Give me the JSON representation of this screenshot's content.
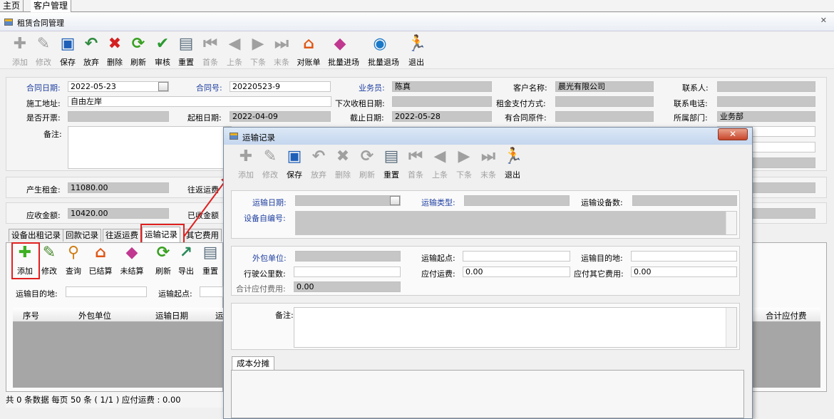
{
  "top_tabs": [
    "主页",
    "客户管理"
  ],
  "window": {
    "title": "租赁合同管理",
    "close": "✕"
  },
  "toolbar": [
    {
      "label": "添加",
      "icon": "add-icon",
      "glyph": "✚",
      "color": "#a0a0a0",
      "disabled": true
    },
    {
      "label": "修改",
      "icon": "edit-icon",
      "glyph": "✎",
      "color": "#a0a0a0",
      "disabled": true
    },
    {
      "label": "保存",
      "icon": "save-icon",
      "glyph": "▣",
      "color": "#1e5fb8",
      "disabled": false
    },
    {
      "label": "放弃",
      "icon": "undo-icon",
      "glyph": "↶",
      "color": "#2e8b3e",
      "disabled": false
    },
    {
      "label": "删除",
      "icon": "delete-icon",
      "glyph": "✖",
      "color": "#d42020",
      "disabled": false
    },
    {
      "label": "刷新",
      "icon": "refresh-icon",
      "glyph": "⟳",
      "color": "#38a020",
      "disabled": false
    },
    {
      "label": "审核",
      "icon": "spellcheck-icon",
      "glyph": "✔",
      "color": "#2a9a30",
      "disabled": false
    },
    {
      "label": "重置",
      "icon": "reset-icon",
      "glyph": "▤",
      "color": "#5a6e7e",
      "disabled": false
    },
    {
      "label": "首条",
      "icon": "first-record-icon",
      "glyph": "⏮",
      "color": "#a0a0a0",
      "disabled": true
    },
    {
      "label": "上条",
      "icon": "previous-record-icon",
      "glyph": "◀",
      "color": "#a0a0a0",
      "disabled": true
    },
    {
      "label": "下条",
      "icon": "next-record-icon",
      "glyph": "▶",
      "color": "#a0a0a0",
      "disabled": true
    },
    {
      "label": "末条",
      "icon": "last-record-icon",
      "glyph": "⏭",
      "color": "#a0a0a0",
      "disabled": true
    },
    {
      "label": "对账单",
      "icon": "statement-icon",
      "glyph": "⌂",
      "color": "#e05818",
      "disabled": false
    },
    {
      "label": "批量进场",
      "icon": "batch-in-icon",
      "glyph": "◆",
      "color": "#c03890",
      "disabled": false
    },
    {
      "label": "批量退场",
      "icon": "batch-out-icon",
      "glyph": "◉",
      "color": "#1a78c8",
      "disabled": false
    },
    {
      "label": "退出",
      "icon": "exit-icon",
      "glyph": "🏃",
      "color": "#1f4fc8",
      "disabled": false
    }
  ],
  "form": {
    "contract_date_label": "合同日期:",
    "contract_date": "2022-05-23",
    "contract_no_label": "合同号:",
    "contract_no": "20220523-9",
    "salesman_label": "业务员:",
    "salesman": "陈真",
    "customer_label": "客户名称:",
    "customer": "晨光有限公司",
    "contact_label": "联系人:",
    "contact": "",
    "site_label": "施工地址:",
    "site": "自由左岸",
    "next_rent_label": "下次收租日期:",
    "next_rent": "",
    "pay_method_label": "租金支付方式:",
    "pay_method": "",
    "phone_label": "联系电话:",
    "phone": "",
    "invoice_label": "是否开票:",
    "invoice": "",
    "start_label": "起租日期:",
    "start": "2022-04-09",
    "end_label": "截止日期:",
    "end": "2022-05-28",
    "original_label": "有合同原件:",
    "original": "",
    "dept_label": "所属部门:",
    "dept": "业务部",
    "remark_label": "备注:",
    "rent_label": "产生租金:",
    "rent": "11080.00",
    "roundtrip_label": "往返运费",
    "receivable_label": "应收金额:",
    "receivable": "10420.00",
    "received_label": "已收金额"
  },
  "lower_tabs": [
    "设备出租记录",
    "回款记录",
    "往返运费",
    "运输记录",
    "其它费用"
  ],
  "sub_toolbar": [
    {
      "label": "添加",
      "icon": "add-icon",
      "glyph": "✚",
      "color": "#3cb020"
    },
    {
      "label": "修改",
      "icon": "edit-icon",
      "glyph": "✎",
      "color": "#4a8a30"
    },
    {
      "label": "查询",
      "icon": "search-icon",
      "glyph": "⚲",
      "color": "#d08018"
    },
    {
      "label": "已结算",
      "icon": "settled-icon",
      "glyph": "⌂",
      "color": "#e05818"
    },
    {
      "label": "未结算",
      "icon": "unsettled-icon",
      "glyph": "◆",
      "color": "#c03890"
    },
    {
      "label": "刷新",
      "icon": "refresh-icon",
      "glyph": "⟳",
      "color": "#38a020"
    },
    {
      "label": "导出",
      "icon": "export-icon",
      "glyph": "↗",
      "color": "#2a8a5a"
    },
    {
      "label": "重置",
      "icon": "reset-icon",
      "glyph": "▤",
      "color": "#5a6e7e"
    }
  ],
  "filter": {
    "dest_label": "运输目的地:",
    "origin_label": "运输起点:"
  },
  "grid_headers": [
    "序号",
    "外包单位",
    "运输日期",
    "运",
    "合计应付费"
  ],
  "status": "共 0 条数据  每页 50 条 ( 1/1 )  应付运费 : 0.00",
  "dialog": {
    "title": "运输记录",
    "close": "✕",
    "toolbar": [
      {
        "label": "添加",
        "icon": "add-icon",
        "glyph": "✚",
        "color": "#a0a0a0",
        "disabled": true
      },
      {
        "label": "修改",
        "icon": "edit-icon",
        "glyph": "✎",
        "color": "#a0a0a0",
        "disabled": true
      },
      {
        "label": "保存",
        "icon": "save-icon",
        "glyph": "▣",
        "color": "#1e5fb8",
        "disabled": false
      },
      {
        "label": "放弃",
        "icon": "undo-icon",
        "glyph": "↶",
        "color": "#a0a0a0",
        "disabled": true
      },
      {
        "label": "删除",
        "icon": "delete-icon",
        "glyph": "✖",
        "color": "#a0a0a0",
        "disabled": true
      },
      {
        "label": "刷新",
        "icon": "refresh-icon",
        "glyph": "⟳",
        "color": "#a0a0a0",
        "disabled": true
      },
      {
        "label": "重置",
        "icon": "reset-icon",
        "glyph": "▤",
        "color": "#5a6e7e",
        "disabled": false
      },
      {
        "label": "首条",
        "icon": "first-record-icon",
        "glyph": "⏮",
        "color": "#a0a0a0",
        "disabled": true
      },
      {
        "label": "上条",
        "icon": "previous-record-icon",
        "glyph": "◀",
        "color": "#a0a0a0",
        "disabled": true
      },
      {
        "label": "下条",
        "icon": "next-record-icon",
        "glyph": "▶",
        "color": "#a0a0a0",
        "disabled": true
      },
      {
        "label": "末条",
        "icon": "last-record-icon",
        "glyph": "⏭",
        "color": "#a0a0a0",
        "disabled": true
      },
      {
        "label": "退出",
        "icon": "exit-icon",
        "glyph": "🏃",
        "color": "#1f4fc8",
        "disabled": false
      }
    ],
    "fields": {
      "date_label": "运输日期:",
      "type_label": "运输类型:",
      "count_label": "运输设备数:",
      "serial_label": "设备自编号:",
      "vendor_label": "外包单位:",
      "origin_label": "运输起点:",
      "dest_label": "运输目的地:",
      "km_label": "行驶公里数:",
      "freight_label": "应付运费:",
      "freight": "0.00",
      "other_label": "应付其它费用:",
      "other": "0.00",
      "total_label": "合计应付费用:",
      "total": "0.00",
      "remark_label": "备注:"
    },
    "cost_tab": "成本分摊"
  },
  "colors": {
    "label_blue": "#1f3fa0",
    "highlight_red": "#e02020",
    "field_gray": "#c6c6c6"
  }
}
